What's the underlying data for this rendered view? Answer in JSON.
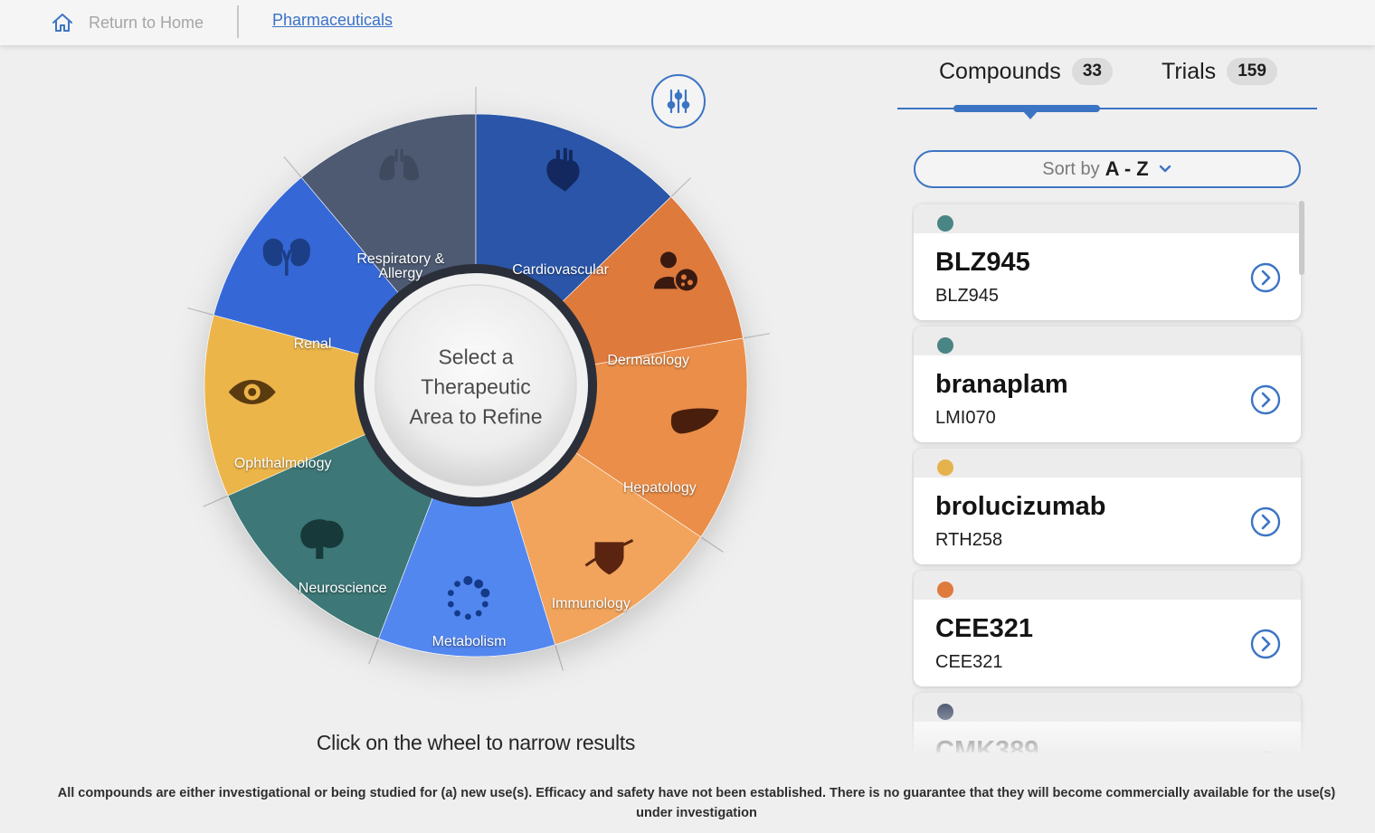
{
  "nav": {
    "home_label": "Return to Home",
    "breadcrumb": "Pharmaceuticals"
  },
  "wheel": {
    "center_lines": [
      "Select a",
      "Therapeutic",
      "Area to Refine"
    ],
    "hint": "Click on the wheel to narrow results",
    "segments": [
      {
        "name": "Respiratory & Allergy",
        "lines": [
          "Respiratory &",
          "Allergy"
        ],
        "color": "#4d5a72",
        "icon": "lungs-icon"
      },
      {
        "name": "Cardiovascular",
        "lines": [
          "Cardiovascular"
        ],
        "color": "#2c55a8",
        "icon": "heart-icon"
      },
      {
        "name": "Dermatology",
        "lines": [
          "Dermatology"
        ],
        "color": "#df7a3c",
        "icon": "person-skin-icon"
      },
      {
        "name": "Hepatology",
        "lines": [
          "Hepatology"
        ],
        "color": "#ea8e48",
        "icon": "liver-icon"
      },
      {
        "name": "Immunology",
        "lines": [
          "Immunology"
        ],
        "color": "#f2a45c",
        "icon": "shield-planet-icon"
      },
      {
        "name": "Metabolism",
        "lines": [
          "Metabolism"
        ],
        "color": "#5287f0",
        "icon": "dots-circle-icon"
      },
      {
        "name": "Neuroscience",
        "lines": [
          "Neuroscience"
        ],
        "color": "#3d7777",
        "icon": "brain-icon"
      },
      {
        "name": "Ophthalmology",
        "lines": [
          "Ophthalmology"
        ],
        "color": "#ecb548",
        "icon": "eye-icon"
      },
      {
        "name": "Renal",
        "lines": [
          "Renal"
        ],
        "color": "#3668d6",
        "icon": "kidneys-icon"
      }
    ]
  },
  "tabs": [
    {
      "label": "Compounds",
      "count": "33",
      "active": true
    },
    {
      "label": "Trials",
      "count": "159",
      "active": false
    }
  ],
  "sort": {
    "prefix": "Sort by",
    "value": "A - Z"
  },
  "compounds": [
    {
      "name": "BLZ945",
      "code": "BLZ945",
      "dot_color": "#4a8585"
    },
    {
      "name": "branaplam",
      "code": "LMI070",
      "dot_color": "#4a8585"
    },
    {
      "name": "brolucizumab",
      "code": "RTH258",
      "dot_color": "#e6b24c"
    },
    {
      "name": "CEE321",
      "code": "CEE321",
      "dot_color": "#de7a3c"
    },
    {
      "name": "CMK389",
      "code": "",
      "dot_color": "#4b5670"
    }
  ],
  "disclaimer": "All compounds are either investigational or being studied for (a) new use(s). Efficacy and safety have not been established. There is no guarantee that they will become commercially available for the use(s) under investigation",
  "colors": {
    "accent": "#3c74c4",
    "text": "#1d1d1d"
  }
}
